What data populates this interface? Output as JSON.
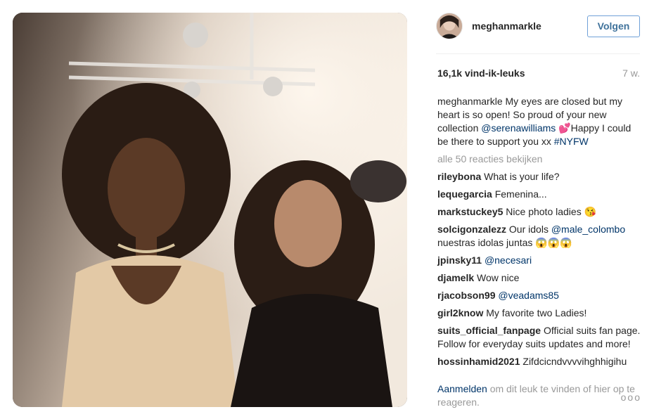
{
  "post": {
    "username": "meghanmarkle",
    "follow_label": "Volgen",
    "likes": "16,1k vind-ik-leuks",
    "age": "7 w.",
    "caption": {
      "user": "meghanmarkle",
      "text1": "My eyes are closed but my heart is so open! So proud of your new collection",
      "mention": "@serenawilliams",
      "emoji": "💕",
      "text2": "Happy I could be there to support you xx",
      "hashtag": "#NYFW"
    },
    "view_all": "alle 50 reacties bekijken",
    "comments": [
      {
        "user": "rileybona",
        "text": "What is your life?",
        "mention": ""
      },
      {
        "user": "lequegarcia",
        "text": "Femenina...",
        "mention": ""
      },
      {
        "user": "markstuckey5",
        "text": "Nice photo ladies 😘",
        "mention": ""
      },
      {
        "user": "solcigonzalezz",
        "text": "Our idols",
        "mention": "@male_colombo",
        "after": "nuestras idolas juntas 😱😱😱"
      },
      {
        "user": "jpinsky11",
        "text": "",
        "mention": "@necesari"
      },
      {
        "user": "djamelk",
        "text": "Wow nice",
        "mention": ""
      },
      {
        "user": "rjacobson99",
        "text": "",
        "mention": "@veadams85"
      },
      {
        "user": "girl2know",
        "text": "My favorite two Ladies!",
        "mention": ""
      },
      {
        "user": "suits_official_fanpage",
        "text": "Official suits fan page. Follow for everyday suits updates and more!",
        "mention": ""
      },
      {
        "user": "hossinhamid2021",
        "text": "Zifdcicndvvvvihghhigihu",
        "mention": ""
      }
    ],
    "footer": {
      "login": "Aanmelden",
      "rest": "om dit leuk te vinden of hier op te reageren.",
      "more": "ooo"
    }
  },
  "colors": {
    "link": "#003569",
    "follow_border": "#70a1d8",
    "muted": "#999999"
  },
  "icons": {
    "more": "ellipsis-icon"
  }
}
